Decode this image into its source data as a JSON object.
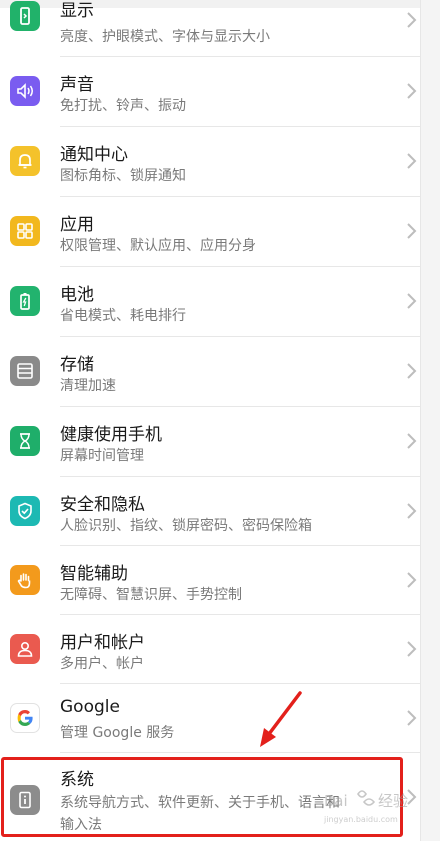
{
  "settings": [
    {
      "title": "显示",
      "subtitle": "亮度、护眼模式、字体与显示大小",
      "icon": "display-icon",
      "color": "#21b26a"
    },
    {
      "title": "声音",
      "subtitle": "免打扰、铃声、振动",
      "icon": "speaker-icon",
      "color": "#7a5cf0"
    },
    {
      "title": "通知中心",
      "subtitle": "图标角标、锁屏通知",
      "icon": "bell-icon",
      "color": "#f4c22b"
    },
    {
      "title": "应用",
      "subtitle": "权限管理、默认应用、应用分身",
      "icon": "apps-grid-icon",
      "color": "#f2b81e"
    },
    {
      "title": "电池",
      "subtitle": "省电模式、耗电排行",
      "icon": "battery-icon",
      "color": "#22b36e"
    },
    {
      "title": "存储",
      "subtitle": "清理加速",
      "icon": "storage-icon",
      "color": "#8a8a8a"
    },
    {
      "title": "健康使用手机",
      "subtitle": "屏幕时间管理",
      "icon": "hourglass-icon",
      "color": "#1fae6a"
    },
    {
      "title": "安全和隐私",
      "subtitle": "人脸识别、指纹、锁屏密码、密码保险箱",
      "icon": "shield-check-icon",
      "color": "#1db9b3"
    },
    {
      "title": "智能辅助",
      "subtitle": "无障碍、智慧识屏、手势控制",
      "icon": "hand-icon",
      "color": "#f39a1c"
    },
    {
      "title": "用户和帐户",
      "subtitle": "多用户、帐户",
      "icon": "user-icon",
      "color": "#ea5a4f"
    },
    {
      "title": "Google",
      "subtitle": "管理 Google 服务",
      "icon": "google-logo-icon",
      "color": "#ffffff"
    },
    {
      "title": "系统",
      "subtitle": "系统导航方式、软件更新、关于手机、语言和",
      "subtitle2": "输入法",
      "icon": "phone-info-icon",
      "color": "#8c8c8c"
    }
  ],
  "watermark": {
    "brand": "Bai",
    "brand2": "经验",
    "url": "jingyan.baidu.com"
  },
  "colors": {
    "highlight": "#e3201b",
    "chevron": "#bdbdbd"
  }
}
